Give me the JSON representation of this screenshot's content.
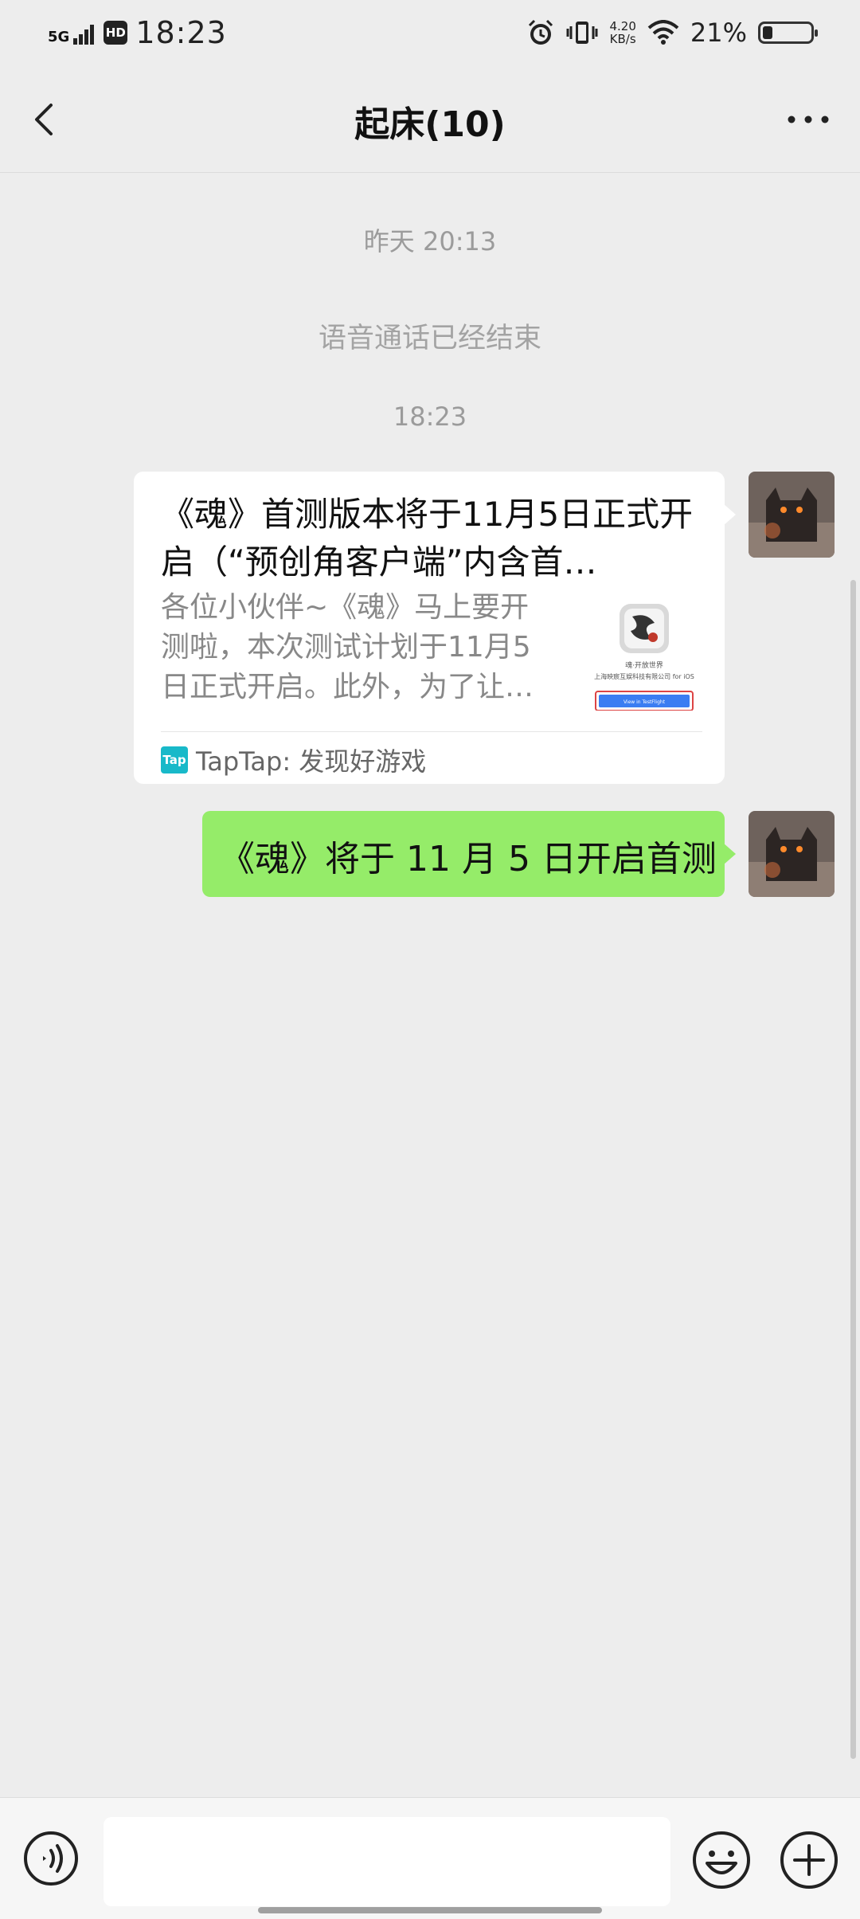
{
  "status_bar": {
    "network": "5G",
    "hd": "HD",
    "time": "18:23",
    "net_speed_value": "4.20",
    "net_speed_unit": "KB/s",
    "battery_percent": "21%",
    "battery_level": 0.21
  },
  "nav": {
    "title": "起床(10)"
  },
  "messages": {
    "timestamp_1": "昨天 20:13",
    "system_notice": "语音通话已经结束",
    "timestamp_2": "18:23",
    "link_card": {
      "title": "《魂》首测版本将于11月5日正式开启（“预创角客户端”内含首…",
      "description": "各位小伙伴~《魂》马上要开测啦，本次测试计划于11月5日正式开启。此外，为了让…",
      "thumb_caption_1": "魂·开放世界",
      "thumb_caption_2": "上海映宸互娱科技有限公司 for iOS",
      "thumb_button": "View in TestFlight",
      "source_logo": "Tap",
      "source": "TapTap: 发现好游戏"
    },
    "text_message": "《魂》将于 11 月 5 日开启首测"
  },
  "input_bar": {
    "text_value": "",
    "icons": [
      "voice-icon",
      "emoji-icon",
      "plus-icon"
    ]
  },
  "colors": {
    "background": "#ededed",
    "sent_bubble": "#95ec69",
    "tap_brand": "#18b9c9"
  }
}
